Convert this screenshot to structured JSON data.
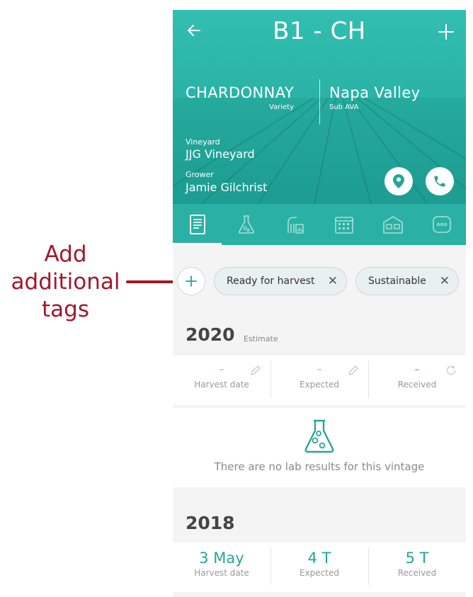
{
  "annotation": {
    "lines": [
      "Add",
      "additional",
      "tags"
    ],
    "color": "#a3172a"
  },
  "header": {
    "title": "B1 - CH",
    "variety": "CHARDONNAY",
    "variety_label": "Variety",
    "ava": "Napa Valley",
    "ava_label": "Sub AVA",
    "vineyard_label": "Vineyard",
    "vineyard": "JJG Vineyard",
    "grower_label": "Grower",
    "grower": "Jamie Gilchrist",
    "accent": "#2ab0a4"
  },
  "tabs": [
    {
      "icon": "document-icon",
      "active": true
    },
    {
      "icon": "flask-icon",
      "active": false
    },
    {
      "icon": "grape-chart-icon",
      "active": false
    },
    {
      "icon": "calendar-icon",
      "active": false
    },
    {
      "icon": "winery-icon",
      "active": false
    },
    {
      "icon": "more-icon",
      "active": false
    }
  ],
  "tags": [
    {
      "label": "Ready for harvest"
    },
    {
      "label": "Sustainable"
    }
  ],
  "vintages": [
    {
      "year": "2020",
      "sub": "Estimate",
      "stats": [
        {
          "value": "–",
          "label": "Harvest date",
          "value_color": "#d4b400"
        },
        {
          "value": "–",
          "label": "Expected",
          "value_color": "#d4b400"
        },
        {
          "value": "–",
          "label": "Received",
          "value_color": "#26a69a"
        }
      ],
      "lab_message": "There are no lab results for this vintage"
    },
    {
      "year": "2018",
      "stats": [
        {
          "value": "3 May",
          "label": "Harvest date"
        },
        {
          "value": "4 T",
          "label": "Expected"
        },
        {
          "value": "5 T",
          "label": "Received"
        }
      ]
    }
  ]
}
